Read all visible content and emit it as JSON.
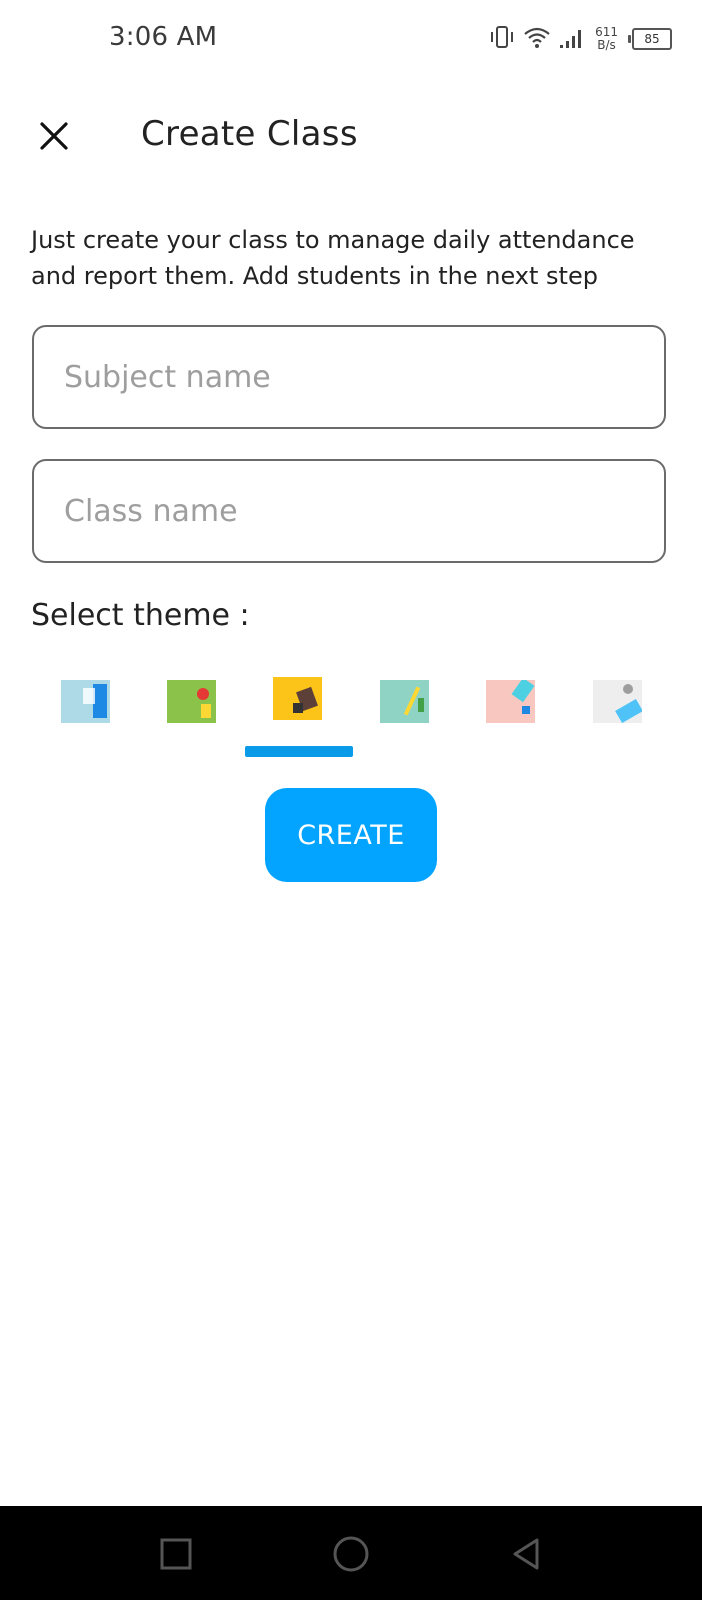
{
  "status_bar": {
    "time": "3:06 AM",
    "net_speed_value": "611",
    "net_speed_unit": "B/s",
    "battery": "85",
    "icons": [
      "vibrate-icon",
      "wifi-icon",
      "signal-icon",
      "battery-icon"
    ]
  },
  "app_bar": {
    "title": "Create Class",
    "close_icon": "close-icon"
  },
  "description": "Just create your class to manage daily attendance and report them. Add students in the next step",
  "form": {
    "subject": {
      "placeholder": "Subject name",
      "value": ""
    },
    "class": {
      "placeholder": "Class name",
      "value": ""
    }
  },
  "theme_section": {
    "label": "Select theme :",
    "selected_index": 2,
    "themes": [
      {
        "name": "theme-blue",
        "color": "#aed9e6",
        "accent": "#1e88e5"
      },
      {
        "name": "theme-green",
        "color": "#8bc34a",
        "accent": "#e53935"
      },
      {
        "name": "theme-yellow",
        "color": "#fcc419",
        "accent": "#5d4037"
      },
      {
        "name": "theme-mint",
        "color": "#8fd3c4",
        "accent": "#fdd835"
      },
      {
        "name": "theme-pink",
        "color": "#f8c8c0",
        "accent": "#4dd0e1"
      },
      {
        "name": "theme-white",
        "color": "#eeeeee",
        "accent": "#4fc3f7"
      }
    ]
  },
  "create_button": {
    "label": "CREATE",
    "color": "#03a4ff"
  },
  "nav_bar": {
    "icons": [
      "recents-square-icon",
      "home-circle-icon",
      "back-triangle-icon"
    ]
  }
}
